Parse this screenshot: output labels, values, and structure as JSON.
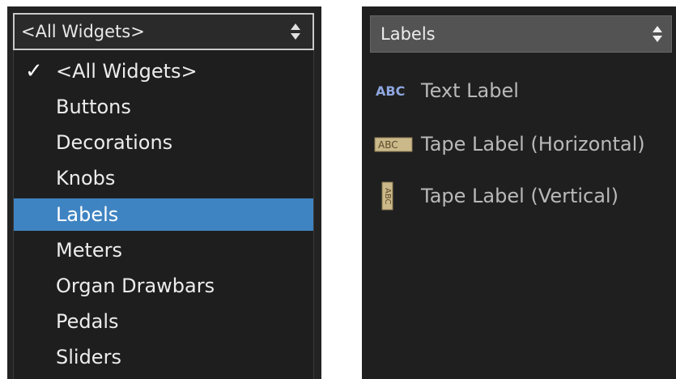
{
  "left": {
    "select_value": "<All Widgets>",
    "items": [
      {
        "label": "<All Widgets>",
        "checked": true
      },
      {
        "label": "Buttons"
      },
      {
        "label": "Decorations"
      },
      {
        "label": "Knobs"
      },
      {
        "label": "Labels",
        "highlighted": true
      },
      {
        "label": "Meters"
      },
      {
        "label": "Organ Drawbars"
      },
      {
        "label": "Pedals"
      },
      {
        "label": "Sliders"
      }
    ],
    "checkmark": "✓"
  },
  "right": {
    "select_value": "Labels",
    "widgets": [
      {
        "label": "Text Label",
        "icon": "abc-text-icon",
        "icon_text": "ABC"
      },
      {
        "label": "Tape Label (Horizontal)",
        "icon": "tape-horizontal-icon",
        "icon_text": "ABC"
      },
      {
        "label": "Tape Label (Vertical)",
        "icon": "tape-vertical-icon",
        "icon_text": "ABC"
      }
    ]
  },
  "colors": {
    "highlight": "#3f84c2",
    "panel_bg": "#232323",
    "text": "#ececec",
    "muted_text": "#b9b9b9"
  }
}
